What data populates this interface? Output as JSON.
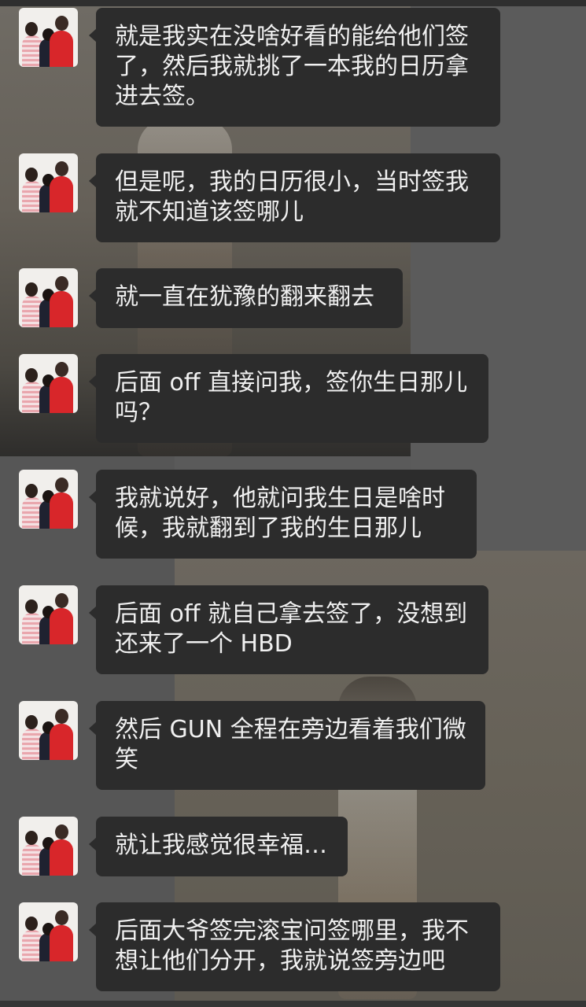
{
  "chat": {
    "messages": [
      {
        "text": "就是我实在没啥好看的能给他们签\n了，然后我就挑了一本我的日历拿\n进去签。"
      },
      {
        "text": "但是呢，我的日历很小，当时签我\n就不知道该签哪儿"
      },
      {
        "text": "就一直在犹豫的翻来翻去"
      },
      {
        "text": "后面 off 直接问我，签你生日那儿\n吗？"
      },
      {
        "text": "我就说好，他就问我生日是啥时\n候，我就翻到了我的生日那儿"
      },
      {
        "text": "后面 off 就自己拿去签了，没想到\n还来了一个 HBD"
      },
      {
        "text": "然后 GUN 全程在旁边看着我们微\n笑"
      },
      {
        "text": "就让我感觉很幸福…"
      },
      {
        "text": "后面大爷签完滚宝问签哪里，我不\n想让他们分开，我就说签旁边吧"
      }
    ]
  }
}
